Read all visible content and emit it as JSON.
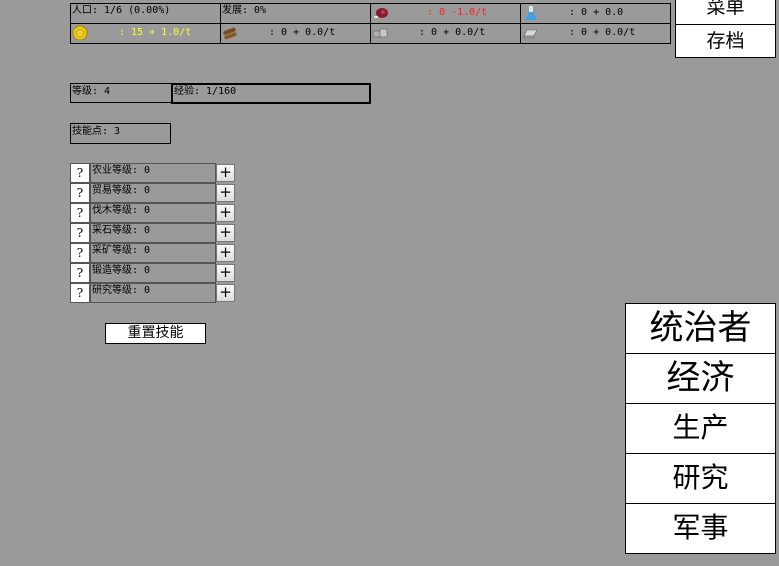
{
  "resources": {
    "population": "人口: 1/6 (0.00%)",
    "development": "发展: 0%",
    "food": ": 0 -1.0/t",
    "research": ": 0 + 0.0",
    "gold": ": 15 + 1.0/t",
    "wood": ": 0 + 0.0/t",
    "stone": ": 0 + 0.0/t",
    "metal": ": 0 + 0.0/t",
    "colors": {
      "food": "#ff2020",
      "gold": "#ffff30"
    }
  },
  "menu": {
    "menu_label": "菜单",
    "save_label": "存档"
  },
  "player": {
    "level": "等级: 4",
    "experience": "经验: 1/160",
    "skill_points": "技能点: 3"
  },
  "skills": {
    "help_label": "?",
    "add_label": "+",
    "items": [
      {
        "label": "农业等级: 0"
      },
      {
        "label": "贸易等级: 0"
      },
      {
        "label": "伐木等级: 0"
      },
      {
        "label": "采石等级: 0"
      },
      {
        "label": "采矿等级: 0"
      },
      {
        "label": "锻造等级: 0"
      },
      {
        "label": "研究等级: 0"
      }
    ],
    "reset_label": "重置技能"
  },
  "nav": {
    "ruler": "统治者",
    "economy": "经济",
    "production": "生产",
    "research": "研究",
    "military": "军事"
  }
}
